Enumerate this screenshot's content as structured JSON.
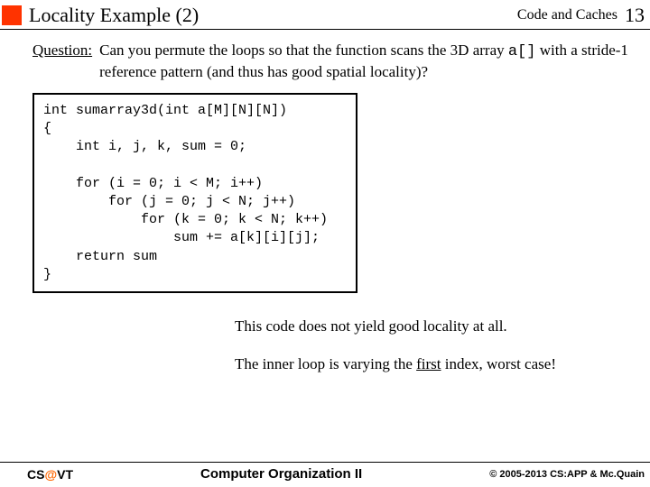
{
  "header": {
    "title": "Locality Example (2)",
    "chapter": "Code and Caches",
    "slide_number": "13"
  },
  "question": {
    "label": "Question:",
    "text_before_code": "Can you permute the loops so that the function scans the 3D array ",
    "inline_code": "a[]",
    "text_after_code": " with a stride-1 reference pattern (and thus has good spatial locality)?"
  },
  "code": "int sumarray3d(int a[M][N][N])\n{\n    int i, j, k, sum = 0;\n\n    for (i = 0; i < M; i++)\n        for (j = 0; j < N; j++)\n            for (k = 0; k < N; k++)\n                sum += a[k][i][j];\n    return sum\n}",
  "commentary": {
    "line1": "This code does not yield good locality at all.",
    "line2_before": "The inner loop is varying the ",
    "line2_underlined": "first",
    "line2_after": " index, worst case!"
  },
  "footer": {
    "left_cs": "CS",
    "left_at": "@",
    "left_vt": "VT",
    "center": "Computer Organization II",
    "right": "© 2005-2013 CS:APP & Mc.Quain"
  }
}
